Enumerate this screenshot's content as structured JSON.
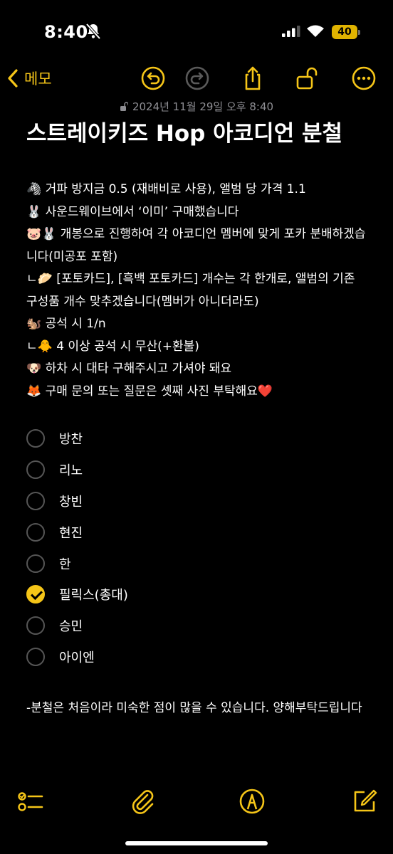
{
  "status": {
    "time": "8:40",
    "battery": "40"
  },
  "nav": {
    "back_label": "메모"
  },
  "note": {
    "date": "2024년 11월 29일 오후 8:40",
    "title": "스트레이키즈 Hop 아코디언 분철",
    "lines": [
      "🦓 거파 방지금 0.5 (재배비로 사용), 앨범 당 가격 1.1",
      "🐰 사운드웨이브에서 ‘이미’ 구매했습니다",
      "🐷🐰 개봉으로 진행하여 각 아코디언 멤버에 맞게 포카 분배하겠습니다(미공포 포함)",
      "ㄴ🥟 [포토카드], [흑백 포토카드] 개수는 각 한개로, 앨범의 기존 구성품 개수 맞추겠습니다(멤버가 아니더라도)",
      "🐿️ 공석 시 1/n",
      "ㄴ🐥 4 이상 공석 시 무산(+환불)",
      "🐶 하차 시 대타 구해주시고 가셔야 돼요",
      "🦊 구매 문의 또는 질문은 셋째 사진 부탁해요❤️"
    ],
    "checklist": [
      {
        "label": "방찬",
        "checked": false
      },
      {
        "label": "리노",
        "checked": false
      },
      {
        "label": "창빈",
        "checked": false
      },
      {
        "label": "현진",
        "checked": false
      },
      {
        "label": "한",
        "checked": false
      },
      {
        "label": "필릭스(총대)",
        "checked": true
      },
      {
        "label": "승민",
        "checked": false
      },
      {
        "label": "아이엔",
        "checked": false
      }
    ],
    "footer": "-분철은 처음이라 미숙한 점이 많을 수 있습니다. 양해부탁드립니다"
  },
  "colors": {
    "accent": "#f5c518",
    "background": "#000000",
    "secondary": "#8e8e93"
  },
  "icons": {
    "nav": [
      "chevron-left-icon",
      "undo-icon",
      "redo-icon",
      "share-icon",
      "lock-open-icon",
      "more-icon"
    ],
    "toolbar": [
      "checklist-icon",
      "paperclip-icon",
      "markup-icon",
      "compose-icon"
    ]
  }
}
